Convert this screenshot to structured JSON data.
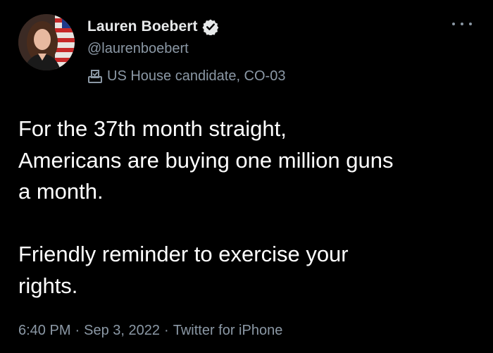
{
  "author": {
    "display_name": "Lauren Boebert",
    "handle": "@laurenboebert",
    "verified_icon": "verified-badge-icon",
    "label_icon": "ballot-box-icon",
    "label": "US House candidate, CO-03"
  },
  "tweet": {
    "paragraph_1": "For the 37th month straight,\nAmericans are buying one million guns\na month.",
    "paragraph_2": "Friendly reminder to exercise your\nrights.",
    "time": "6:40 PM",
    "separator": "·",
    "date": "Sep 3, 2022",
    "source": "Twitter for iPhone"
  },
  "menu_icon": "more-options-icon",
  "colors": {
    "background": "#000000",
    "text_primary": "#ffffff",
    "text_secondary": "#8b98a5",
    "verified_badge": "#e7e9ea"
  }
}
